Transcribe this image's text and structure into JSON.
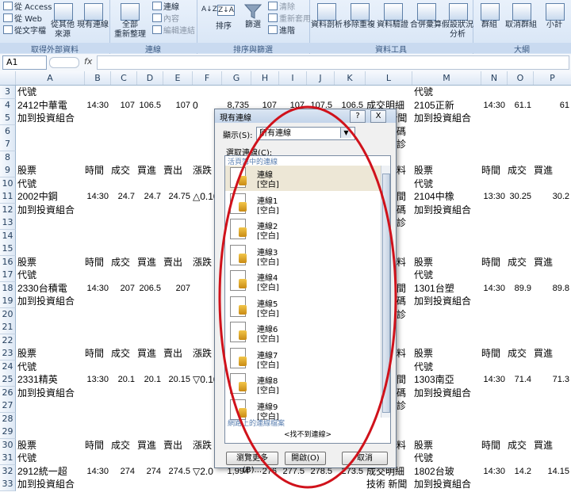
{
  "ribbon": {
    "groups": [
      {
        "label": "取得外部資料"
      },
      {
        "label": "連線"
      },
      {
        "label": "排序與篩選"
      },
      {
        "label": "資料工具"
      },
      {
        "label": "大綱"
      }
    ],
    "from_access": "從 Access",
    "from_web": "從 Web",
    "from_text": "從文字檔",
    "from_other": "從其他\n來源",
    "existing": "現有連線",
    "refresh_all": "全部\n重新整理",
    "connections": "連線",
    "properties": "內容",
    "edit_links": "編輯連結",
    "sort_az": "A↓Z",
    "sort_za": "Z↓A",
    "sort": "排序",
    "filter": "篩選",
    "clear": "清除",
    "reapply": "重新套用",
    "advanced": "進階",
    "text_to_columns": "資料剖析",
    "remove_dup": "移除重複",
    "validation": "資料驗證",
    "consolidate": "合併彙算",
    "whatif": "假設狀況\n分析",
    "group": "群組",
    "ungroup": "取消群組",
    "subtotal": "小計"
  },
  "formula_bar": {
    "name_box": "A1",
    "fx": "fx"
  },
  "columns": [
    "A",
    "B",
    "C",
    "D",
    "E",
    "F",
    "G",
    "H",
    "I",
    "J",
    "K",
    "L",
    "M",
    "N",
    "O",
    "P"
  ],
  "rows": [
    "3",
    "4",
    "5",
    "6",
    "7",
    "8",
    "9",
    "10",
    "11",
    "12",
    "13",
    "14",
    "15",
    "16",
    "17",
    "18",
    "19",
    "20",
    "21",
    "22",
    "23",
    "24",
    "25",
    "26",
    "27",
    "28",
    "29",
    "30",
    "31",
    "32",
    "33"
  ],
  "cells": {
    "r3a": "代號",
    "r4a": "2412中華電",
    "r4b": "14:30",
    "r4c": "107",
    "r4d": "106.5",
    "r4e": "107",
    "r4f": "0",
    "r4g": "8,735",
    "r4h": "107",
    "r4i": "107",
    "r4j": "107.5",
    "r4k": "106.5",
    "r4l": "成交明細",
    "r5a": "加到投資組合",
    "r5l": "技術 新聞",
    "r3m": "代號",
    "r4m": "2105正新",
    "r4n": "14:30",
    "r4o": "61.1",
    "r4p": "61",
    "r5m": "加到投資組合",
    "hdr_a": "股票",
    "hdr_b": "時間",
    "hdr_c": "成交",
    "hdr_d": "買進",
    "hdr_e": "賣出",
    "hdr_f": "漲跌",
    "r10a": "代號",
    "r11a": "2002中鋼",
    "r11b": "14:30",
    "r11c": "24.7",
    "r11d": "24.7",
    "r11e": "24.75",
    "r11f": "△0.10",
    "r12a": "加到投資組合",
    "r10m": "代號",
    "r11m": "2104中橡",
    "r11n": "13:30",
    "r11o": "30.25",
    "r11p": "30.2",
    "r12m": "加到投資組合",
    "r17a": "代號",
    "r18a": "2330台積電",
    "r18b": "14:30",
    "r18c": "207",
    "r18d": "206.5",
    "r18e": "207",
    "r19a": "加到投資組合",
    "r17m": "代號",
    "r18m": "1301台塑",
    "r18n": "14:30",
    "r18o": "89.9",
    "r18p": "89.8",
    "r19m": "加到投資組合",
    "r24a": "代號",
    "r25a": "2331精英",
    "r25b": "13:30",
    "r25c": "20.1",
    "r25d": "20.1",
    "r25e": "20.15",
    "r25f": "▽0.10",
    "r26a": "加到投資組合",
    "r24m": "代號",
    "r25m": "1303南亞",
    "r25n": "14:30",
    "r25o": "71.4",
    "r25p": "71.3",
    "r26m": "加到投資組合",
    "r31a": "代號",
    "r32a": "2912統一超",
    "r32b": "14:30",
    "r32c": "274",
    "r32d": "274",
    "r32e": "274.5",
    "r32f": "▽2.0",
    "r32g": "1,994",
    "r32h": "276",
    "r32i": "277.5",
    "r32j": "278.5",
    "r32k": "273.5",
    "r32l": "成交明細",
    "r33a": "加到投資組合",
    "r33l": "技術 新聞",
    "r31m": "代號",
    "r32m": "1802台玻",
    "r32n": "14:30",
    "r32o": "14.2",
    "r32p": "14.15",
    "r33m": "加到投資組合",
    "l_item": "料",
    "l_item2": "間",
    "l_item3": "碼",
    "l_item4": "診"
  },
  "dialog": {
    "title": "現有連線",
    "help": "?",
    "close": "X",
    "show_label": "顯示(S):",
    "show_value": "所有連線",
    "choose_label": "選取連線(C):",
    "section_workbook": "活頁簿中的連線",
    "items": [
      {
        "name": "連線",
        "desc": "[空白]"
      },
      {
        "name": "連線1",
        "desc": "[空白]"
      },
      {
        "name": "連線2",
        "desc": "[空白]"
      },
      {
        "name": "連線3",
        "desc": "[空白]"
      },
      {
        "name": "連線4",
        "desc": "[空白]"
      },
      {
        "name": "連線5",
        "desc": "[空白]"
      },
      {
        "name": "連線6",
        "desc": "[空白]"
      },
      {
        "name": "連線7",
        "desc": "[空白]"
      },
      {
        "name": "連線8",
        "desc": "[空白]"
      },
      {
        "name": "連線9",
        "desc": "[空白]"
      }
    ],
    "section_network": "網路上的連線檔案",
    "none_found": "<找不到連線>",
    "browse": "瀏覽更多(B)...",
    "open": "開啟(O)",
    "cancel": "取消"
  },
  "annotation_color": "#d0121b"
}
